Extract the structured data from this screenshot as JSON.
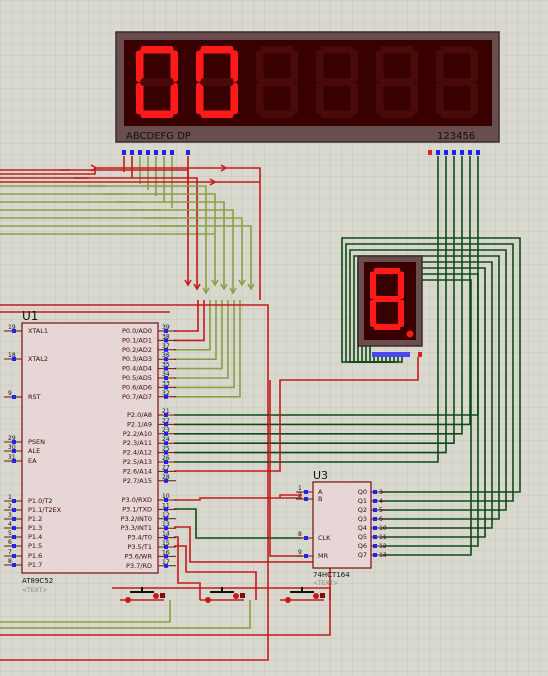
{
  "display6": {
    "segment_label": "ABCDEFG DP",
    "digit_label": "123456",
    "digits_lit": [
      true,
      true,
      false,
      false,
      false,
      false
    ]
  },
  "display1": {
    "digit_lit": true
  },
  "u1": {
    "ref": "U1",
    "part": "AT89C52",
    "text_tag": "<TEXT>",
    "left_pins": [
      {
        "num": "19",
        "name": "XTAL1"
      },
      {
        "num": "18",
        "name": "XTAL2"
      },
      {
        "num": "9",
        "name": "RST"
      },
      {
        "num": "29",
        "name": "PSEN"
      },
      {
        "num": "30",
        "name": "ALE"
      },
      {
        "num": "31",
        "name": "EA"
      },
      {
        "num": "1",
        "name": "P1.0/T2"
      },
      {
        "num": "2",
        "name": "P1.1/T2EX"
      },
      {
        "num": "3",
        "name": "P1.2"
      },
      {
        "num": "4",
        "name": "P1.3"
      },
      {
        "num": "5",
        "name": "P1.4"
      },
      {
        "num": "6",
        "name": "P1.5"
      },
      {
        "num": "7",
        "name": "P1.6"
      },
      {
        "num": "8",
        "name": "P1.7"
      }
    ],
    "right_pins": [
      {
        "num": "39",
        "name": "P0.0/AD0"
      },
      {
        "num": "38",
        "name": "P0.1/AD1"
      },
      {
        "num": "37",
        "name": "P0.2/AD2"
      },
      {
        "num": "36",
        "name": "P0.3/AD3"
      },
      {
        "num": "35",
        "name": "P0.4/AD4"
      },
      {
        "num": "34",
        "name": "P0.5/AD5"
      },
      {
        "num": "33",
        "name": "P0.6/AD6"
      },
      {
        "num": "32",
        "name": "P0.7/AD7"
      },
      {
        "num": "21",
        "name": "P2.0/A8"
      },
      {
        "num": "22",
        "name": "P2.1/A9"
      },
      {
        "num": "23",
        "name": "P2.2/A10"
      },
      {
        "num": "24",
        "name": "P2.3/A11"
      },
      {
        "num": "25",
        "name": "P2.4/A12"
      },
      {
        "num": "26",
        "name": "P2.5/A13"
      },
      {
        "num": "27",
        "name": "P2.6/A14"
      },
      {
        "num": "28",
        "name": "P2.7/A15"
      },
      {
        "num": "10",
        "name": "P3.0/RXD"
      },
      {
        "num": "11",
        "name": "P3.1/TXD"
      },
      {
        "num": "12",
        "name": "P3.2/INT0"
      },
      {
        "num": "13",
        "name": "P3.3/INT1"
      },
      {
        "num": "14",
        "name": "P3.4/T0"
      },
      {
        "num": "15",
        "name": "P3.5/T1"
      },
      {
        "num": "16",
        "name": "P3.6/WR"
      },
      {
        "num": "17",
        "name": "P3.7/RD"
      }
    ]
  },
  "u3": {
    "ref": "U3",
    "part": "74HCT164",
    "text_tag": "<TEXT>",
    "left_pins": [
      {
        "num": "1",
        "name": "A"
      },
      {
        "num": "2",
        "name": "B"
      },
      {
        "num": "8",
        "name": "CLK"
      },
      {
        "num": "9",
        "name": "MR"
      }
    ],
    "right_pins": [
      {
        "num": "3",
        "name": "Q0"
      },
      {
        "num": "4",
        "name": "Q1"
      },
      {
        "num": "5",
        "name": "Q2"
      },
      {
        "num": "6",
        "name": "Q3"
      },
      {
        "num": "10",
        "name": "Q4"
      },
      {
        "num": "11",
        "name": "Q5"
      },
      {
        "num": "12",
        "name": "Q6"
      },
      {
        "num": "13",
        "name": "Q7"
      }
    ]
  },
  "buttons_count": 3,
  "colors": {
    "background": "#d8d8ce",
    "grid": "#c6c6bb",
    "wire_red": "#c41a1a",
    "wire_olive": "#8aa045",
    "wire_green": "#0e4a16",
    "component_body": "#e6d6d6",
    "component_border": "#7a0e0e",
    "display_bezel": "#6a4e4e",
    "display_bg": "#380000",
    "segment_on": "#ff1a1a",
    "segment_off": "#4a0a0a",
    "pin_blue": "#2222ee",
    "pin_red": "#dd2222",
    "text_dark": "#3a0a0a"
  }
}
